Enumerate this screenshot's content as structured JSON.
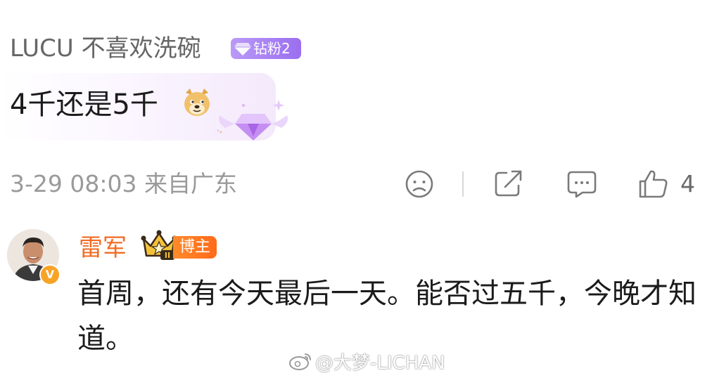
{
  "comment1": {
    "username": "LUCU 不喜欢洗碗",
    "badge": "钻粉2",
    "text": "4千还是5千",
    "emoji_icon": "doge-icon",
    "timestamp": "3-29 08:03",
    "location": "来自广东",
    "likes": "4"
  },
  "comment2": {
    "username": "雷军",
    "badge": "博主",
    "rank": "II",
    "text": "首周，还有今天最后一天。能否过五千，今晚才知道。"
  },
  "watermark": "@大梦-LICHAN",
  "colors": {
    "username_orange": "#f26b22",
    "badge_purple": "#9b6ef0",
    "meta_gray": "#9a9a9a"
  }
}
